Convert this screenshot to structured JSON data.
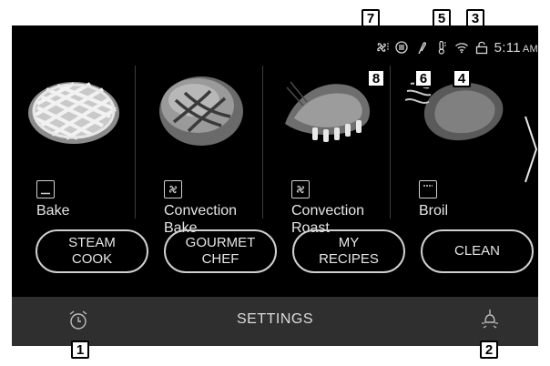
{
  "status": {
    "time": "5:11",
    "ampm": "AM",
    "icons": [
      "fan-icon",
      "steam-icon",
      "probe-icon",
      "thermometer-icon",
      "wifi-icon",
      "lock-icon"
    ]
  },
  "modes": [
    {
      "label": "Bake",
      "icon": "bake-icon",
      "image": "pie"
    },
    {
      "label": "Convection Bake",
      "icon": "fan-icon",
      "image": "bread"
    },
    {
      "label": "Convection Roast",
      "icon": "fan-icon",
      "image": "roast"
    },
    {
      "label": "Broil",
      "icon": "broil-icon",
      "image": "steak"
    }
  ],
  "buttons": [
    {
      "label": "STEAM COOK"
    },
    {
      "label": "GOURMET CHEF"
    },
    {
      "label": "MY RECIPES"
    },
    {
      "label": "CLEAN"
    }
  ],
  "bottom": {
    "settings": "SETTINGS"
  },
  "callouts": [
    "1",
    "2",
    "3",
    "4",
    "5",
    "6",
    "7",
    "8"
  ]
}
